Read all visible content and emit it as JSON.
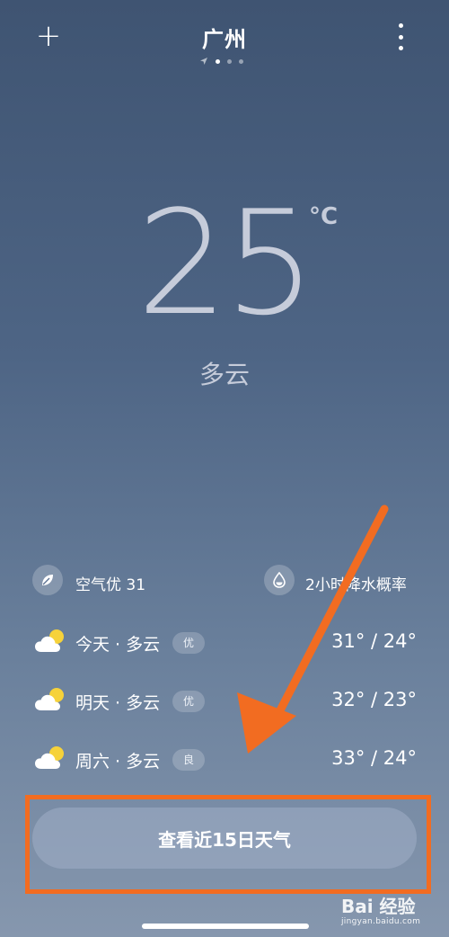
{
  "header": {
    "add_symbol": "+",
    "city": "广州",
    "page_count": 3,
    "active_page": 1
  },
  "current": {
    "temperature": "25",
    "unit": "°C",
    "condition": "多云"
  },
  "air_quality": {
    "label": "空气优 31",
    "icon": "leaf-icon"
  },
  "precipitation": {
    "label": "2小时降水概率",
    "icon": "droplet-icon"
  },
  "forecast": [
    {
      "day": "今天 · 多云",
      "badge": "优",
      "temps": "31° / 24°",
      "icon": "partly-cloudy-icon"
    },
    {
      "day": "明天 · 多云",
      "badge": "优",
      "temps": "32° / 23°",
      "icon": "partly-cloudy-icon"
    },
    {
      "day": "周六 · 多云",
      "badge": "良",
      "temps": "33° / 24°",
      "icon": "partly-cloudy-icon"
    }
  ],
  "button": {
    "label": "查看近15日天气"
  },
  "watermark": {
    "main": "Bai 经验",
    "sub": "jingyan.baidu.com"
  },
  "colors": {
    "accent_orange": "#f26c21",
    "sun_yellow": "#f6d23a"
  }
}
